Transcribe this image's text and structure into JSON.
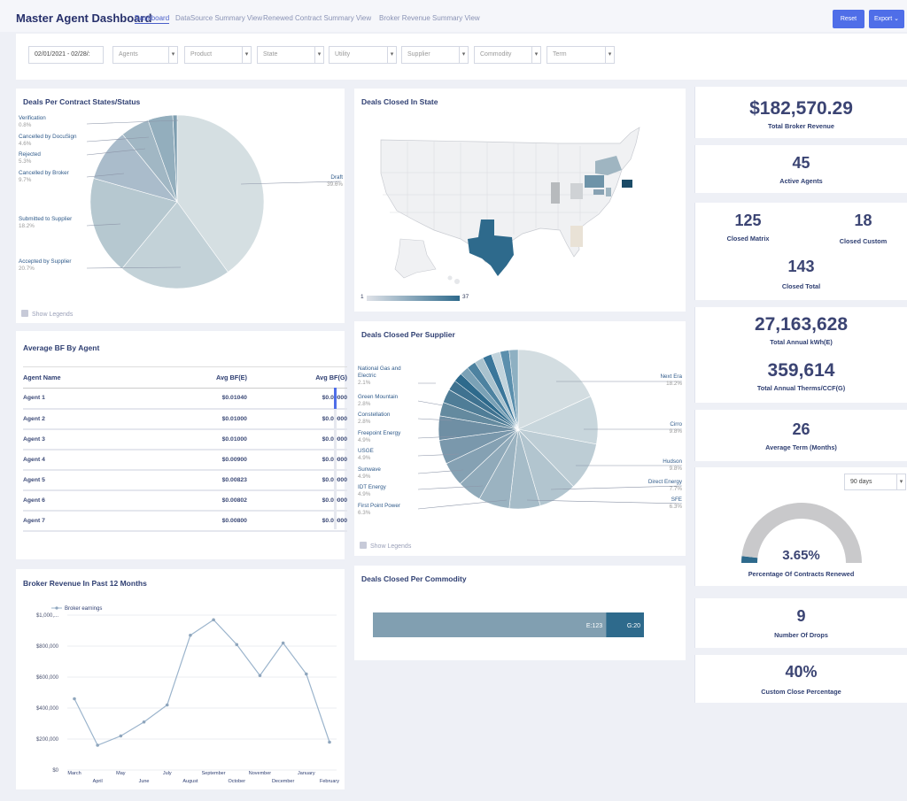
{
  "header": {
    "title": "Master Agent Dashboard",
    "tabs": [
      "Dashboard",
      "DataSource Summary View",
      "Renewed Contract Summary View",
      "Broker Revenue Summary View"
    ],
    "reset_label": "Reset",
    "export_label": "Export"
  },
  "filters": {
    "date": "02/01/2021 - 02/28/:",
    "agents": "Agents",
    "product": "Product",
    "state": "State",
    "utility": "Utility",
    "supplier": "Supplier",
    "commodity": "Commodity",
    "term": "Term",
    "dd_glyph": "▾"
  },
  "contract_states": {
    "title": "Deals Per Contract States/Status",
    "labels": [
      {
        "name": "Verification",
        "pct": "0.8%"
      },
      {
        "name": "Cancelled by DocuSign",
        "pct": "4.6%"
      },
      {
        "name": "Rejected",
        "pct": "5.3%"
      },
      {
        "name": "Cancelled by Broker",
        "pct": "9.7%"
      },
      {
        "name": "Submitted to Supplier",
        "pct": "18.2%"
      },
      {
        "name": "Accepted by Supplier",
        "pct": "20.7%"
      },
      {
        "name": "Draft",
        "pct": "39.6%"
      }
    ],
    "show_legends": "Show Legends"
  },
  "deals_state": {
    "title": "Deals Closed In State",
    "scale_min": "1",
    "scale_max": "37",
    "colors": {
      "low": "#dfe2e8",
      "high": "#2e6a8c"
    }
  },
  "kpis": {
    "revenue": {
      "value": "$182,570.29",
      "label": "Total Broker Revenue"
    },
    "agents": {
      "value": "45",
      "label": "Active Agents"
    },
    "matrix": {
      "value": "125",
      "label": "Closed Matrix"
    },
    "custom": {
      "value": "18",
      "label": "Closed Custom"
    },
    "closed_total": {
      "value": "143",
      "label": "Closed Total"
    },
    "kwh": {
      "value": "27,163,628",
      "label": "Total Annual kWh(E)"
    },
    "therms": {
      "value": "359,614",
      "label": "Total Annual Therms/CCF(G)"
    },
    "term": {
      "value": "26",
      "label": "Average Term (Months)"
    },
    "renewed": {
      "value": "3.65%",
      "label": "Percentage Of Contracts Renewed",
      "days": "90 days",
      "fraction": 0.0365
    },
    "drops": {
      "value": "9",
      "label": "Number Of Drops"
    },
    "custom_pct": {
      "value": "40%",
      "label": "Custom Close Percentage"
    }
  },
  "bf_agent": {
    "title": "Average BF By Agent",
    "headers": [
      "Agent Name",
      "Avg BF(E)",
      "Avg BF(G)"
    ],
    "rows": [
      [
        "Agent 1",
        "$0.01040",
        "$0.00000"
      ],
      [
        "Agent 2",
        "$0.01000",
        "$0.00000"
      ],
      [
        "Agent 3",
        "$0.01000",
        "$0.00000"
      ],
      [
        "Agent 4",
        "$0.00900",
        "$0.00000"
      ],
      [
        "Agent 5",
        "$0.00823",
        "$0.00000"
      ],
      [
        "Agent 6",
        "$0.00802",
        "$0.00000"
      ],
      [
        "Agent 7",
        "$0.00800",
        "$0.00000"
      ]
    ]
  },
  "supplier": {
    "title": "Deals Closed Per Supplier",
    "left_labels": [
      {
        "name": "National Gas and Electric",
        "pct": "2.1%"
      },
      {
        "name": "Green Mountain",
        "pct": "2.8%"
      },
      {
        "name": "Constellation",
        "pct": "2.8%"
      },
      {
        "name": "Freepoint Energy",
        "pct": "4.9%"
      },
      {
        "name": "USGE",
        "pct": "4.9%"
      },
      {
        "name": "Sunwave",
        "pct": "4.9%"
      },
      {
        "name": "IDT Energy",
        "pct": "4.9%"
      },
      {
        "name": "First Point Power",
        "pct": "6.3%"
      }
    ],
    "right_labels": [
      {
        "name": "Next Era",
        "pct": "18.2%"
      },
      {
        "name": "Cirro",
        "pct": "9.8%"
      },
      {
        "name": "Hudson",
        "pct": "9.8%"
      },
      {
        "name": "Direct Energy",
        "pct": "7.7%"
      },
      {
        "name": "SFE",
        "pct": "6.3%"
      }
    ],
    "show_legends": "Show Legends"
  },
  "commodity": {
    "title": "Deals Closed Per Commodity",
    "e_label": "E:123",
    "g_label": "G:20",
    "e_value": 123,
    "g_value": 20
  },
  "revenue_chart": {
    "title": "Broker Revenue In Past 12 Months",
    "legend": "Broker earnings",
    "y_ticks": [
      "$0",
      "$200,000",
      "$400,000",
      "$600,000",
      "$800,000",
      "$1,000,..."
    ]
  },
  "chart_data": [
    {
      "type": "line",
      "title": "Broker Revenue In Past 12 Months",
      "x": [
        "March",
        "April",
        "May",
        "June",
        "July",
        "August",
        "September",
        "October",
        "November",
        "December",
        "January",
        "February"
      ],
      "series": [
        {
          "name": "Broker earnings",
          "values": [
            460000,
            160000,
            220000,
            310000,
            420000,
            870000,
            970000,
            810000,
            610000,
            820000,
            620000,
            180000
          ]
        }
      ],
      "ylim": [
        0,
        1000000
      ],
      "legend": "top-left",
      "grid": true
    },
    {
      "type": "pie",
      "title": "Deals Per Contract States/Status",
      "categories": [
        "Draft",
        "Accepted by Supplier",
        "Submitted to Supplier",
        "Cancelled by Broker",
        "Rejected",
        "Cancelled by DocuSign",
        "Verification"
      ],
      "values": [
        39.6,
        20.7,
        18.2,
        9.7,
        5.3,
        4.6,
        0.8
      ]
    },
    {
      "type": "pie",
      "title": "Deals Closed Per Supplier",
      "categories": [
        "Next Era",
        "Cirro",
        "Hudson",
        "Direct Energy",
        "SFE",
        "First Point Power",
        "IDT Energy",
        "Sunwave",
        "USGE",
        "Freepoint Energy",
        "Constellation",
        "Green Mountain",
        "National Gas and Electric"
      ],
      "values": [
        18.2,
        9.8,
        9.8,
        7.7,
        6.3,
        6.3,
        4.9,
        4.9,
        4.9,
        4.9,
        2.8,
        2.8,
        2.1
      ]
    },
    {
      "type": "bar",
      "title": "Deals Closed Per Commodity",
      "categories": [
        "E",
        "G"
      ],
      "values": [
        123,
        20
      ]
    }
  ]
}
